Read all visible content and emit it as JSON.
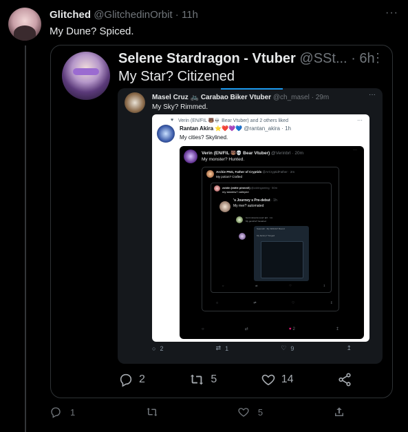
{
  "tweet": {
    "display_name": "Glitched",
    "handle": "@GlitchedinOrbit",
    "separator": "·",
    "time": "11h",
    "text": "My Dune? Spiced.",
    "more": "···",
    "replies": "1",
    "retweets": "",
    "likes": "5"
  },
  "quote": {
    "display_name": "Selene Stardragon - Vtuber",
    "handle": "@SSt...",
    "separator": "·",
    "time": "6h",
    "text": "My Star? Citizened",
    "more": "⋮",
    "replies": "2",
    "retweets": "5",
    "likes": "14"
  },
  "screenshot": {
    "display_name": "Masel Cruz",
    "name_suffix": "Carabao Biker Vtuber",
    "handle": "@ch_masel",
    "time": "29m",
    "text": "My Sky? Rimmed.",
    "more": "···",
    "replies": "2",
    "retweets": "1",
    "likes": "9",
    "white": {
      "liked_line": "Verin (EN/FIL 🐻💀 Bear Vtuber) and 2 others liked",
      "display_name": "Rantan Akira",
      "emoji": "⭐❤️💜💙",
      "handle": "@rantan_akira",
      "time": "1h",
      "text": "My cities? Skylined.",
      "more": "···"
    },
    "dark2": {
      "display_name": "Verin (EN/FIL 🐻💀 Bear Vtuber)",
      "handle": "@Verinbrl",
      "time": "20m",
      "text": "My monster? Hunted.",
      "likes": "2"
    },
    "dark3": {
      "display_name": "Archie PNG, Father of Cryptids",
      "handle": "@ArCryptidFather",
      "time": "2m",
      "text": "My potion? Crafted"
    },
    "dark4": {
      "display_name": "zobiin (rattle pinned!)",
      "handle": "@zobingaming",
      "time": "50m",
      "text": "my stardew? valleyed"
    },
    "dark5": {
      "display_name": "'s Journey s Pre-debut",
      "time": "1h",
      "text": "My mer? automated"
    },
    "deep": {
      "line1": "bunni streams soon! @z · 1m",
      "line2": "My gensfire? hesarted",
      "line3": "Seamoth · My SPACE? Bound",
      "line4": "My factory? Tonged"
    }
  }
}
